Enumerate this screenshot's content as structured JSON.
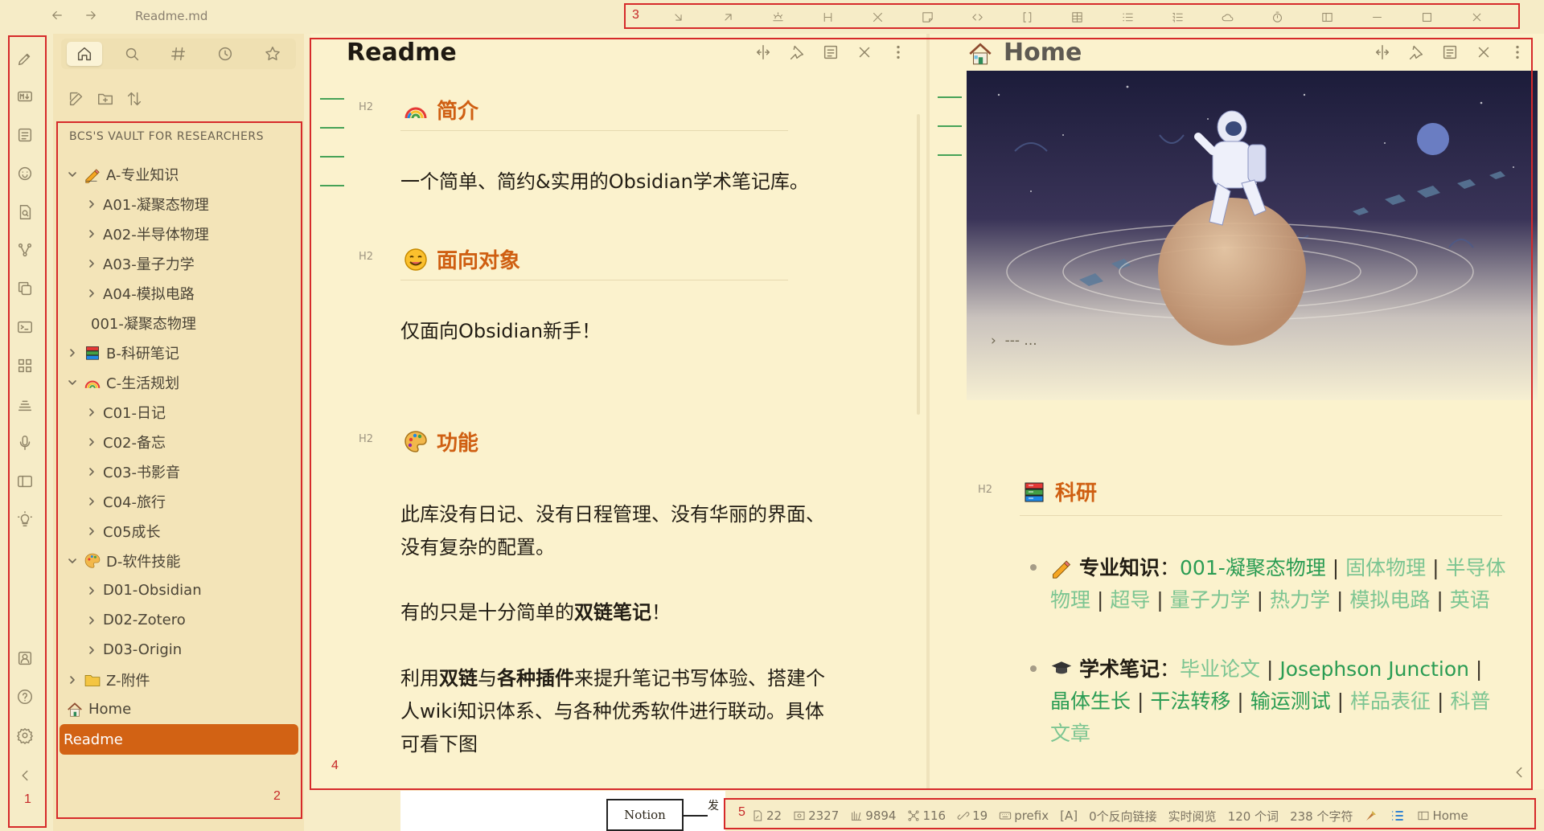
{
  "window": {
    "file_title": "Readme.md"
  },
  "toolbar": {
    "region_num": "3"
  },
  "ribbon": {
    "region_num": "1"
  },
  "sidebar": {
    "region_num": "2",
    "vault_name": "BCS'S VAULT FOR RESEARCHERS",
    "items": [
      {
        "label": "A-专业知识",
        "level": 0,
        "chevron": "down",
        "emoji": "pencil"
      },
      {
        "label": "A01-凝聚态物理",
        "level": 1,
        "chevron": "right"
      },
      {
        "label": "A02-半导体物理",
        "level": 1,
        "chevron": "right"
      },
      {
        "label": "A03-量子力学",
        "level": 1,
        "chevron": "right"
      },
      {
        "label": "A04-模拟电路",
        "level": 1,
        "chevron": "right"
      },
      {
        "label": "001-凝聚态物理",
        "level": 1,
        "chevron": "none"
      },
      {
        "label": "B-科研笔记",
        "level": 0,
        "chevron": "right",
        "emoji": "books"
      },
      {
        "label": "C-生活规划",
        "level": 0,
        "chevron": "down",
        "emoji": "rainbow"
      },
      {
        "label": "C01-日记",
        "level": 1,
        "chevron": "right"
      },
      {
        "label": "C02-备忘",
        "level": 1,
        "chevron": "right"
      },
      {
        "label": "C03-书影音",
        "level": 1,
        "chevron": "right"
      },
      {
        "label": "C04-旅行",
        "level": 1,
        "chevron": "right"
      },
      {
        "label": "C05成长",
        "level": 1,
        "chevron": "right"
      },
      {
        "label": "D-软件技能",
        "level": 0,
        "chevron": "down",
        "emoji": "palette"
      },
      {
        "label": "D01-Obsidian",
        "level": 1,
        "chevron": "right"
      },
      {
        "label": "D02-Zotero",
        "level": 1,
        "chevron": "right"
      },
      {
        "label": "D03-Origin",
        "level": 1,
        "chevron": "right"
      },
      {
        "label": "Z-附件",
        "level": 0,
        "chevron": "right",
        "emoji": "folder"
      },
      {
        "label": "Home",
        "level": 0,
        "chevron": "none",
        "emoji": "house"
      },
      {
        "label": "Readme",
        "level": 0,
        "chevron": "none",
        "active": true
      }
    ]
  },
  "pane_left": {
    "region_num": "4",
    "title": "Readme",
    "h2_tag": "H2",
    "sections": [
      {
        "heading": "简介",
        "emoji": "rainbow"
      },
      {
        "heading": "面向对象",
        "emoji": "smile"
      },
      {
        "heading": "功能",
        "emoji": "palette"
      }
    ],
    "p1": "一个简单、简约&实用的Obsidian学术笔记库。",
    "p2": "仅面向Obsidian新手！",
    "p3_line1": "此库没有日记、没有日程管理、没有华丽的界面、",
    "p3_line2": "没有复杂的配置。",
    "p4_a": "有的只是十分简单的",
    "p4_b": "双链笔记",
    "p4_c": "！",
    "p5_a": "利用",
    "p5_b": "双链",
    "p5_c": "与",
    "p5_d": "各种插件",
    "p5_e": "来提升笔记书写体验、搭建个",
    "p5_line2": "人wiki知识体系、与各种优秀软件进行联动。具体",
    "p5_line3": "可看下图"
  },
  "pane_right": {
    "title": "Home",
    "fold_text": "---   ...",
    "h2_tag": "H2",
    "section_heading": "科研",
    "bullet1_label": "专业知识",
    "bullet1_colon": "：",
    "bullet1_links": [
      "001-凝聚态物理",
      "固体物理",
      "半",
      "导体物理",
      "超导",
      "量子力学",
      "热力学",
      "模拟电路",
      "英语"
    ],
    "bullet2_label": "学术笔记",
    "bullet2_colon": "：",
    "bullet2_links": [
      "毕业论文",
      "Josephson Junction",
      "晶体生长",
      "干法转移",
      "输运测试",
      "样品表征",
      "科",
      "普文章"
    ]
  },
  "bottom_peek": {
    "text1": "Notion",
    "text2": "发"
  },
  "statusbar": {
    "region_num": "5",
    "edits": "22",
    "images": "2327",
    "files": "9894",
    "nodes": "116",
    "links": "19",
    "prefix": "prefix",
    "mode": "[A]",
    "backlinks": "0个反向链接",
    "view": "实时阅览",
    "words": "120 个词",
    "chars": "238 个字符",
    "home": "Home"
  }
}
